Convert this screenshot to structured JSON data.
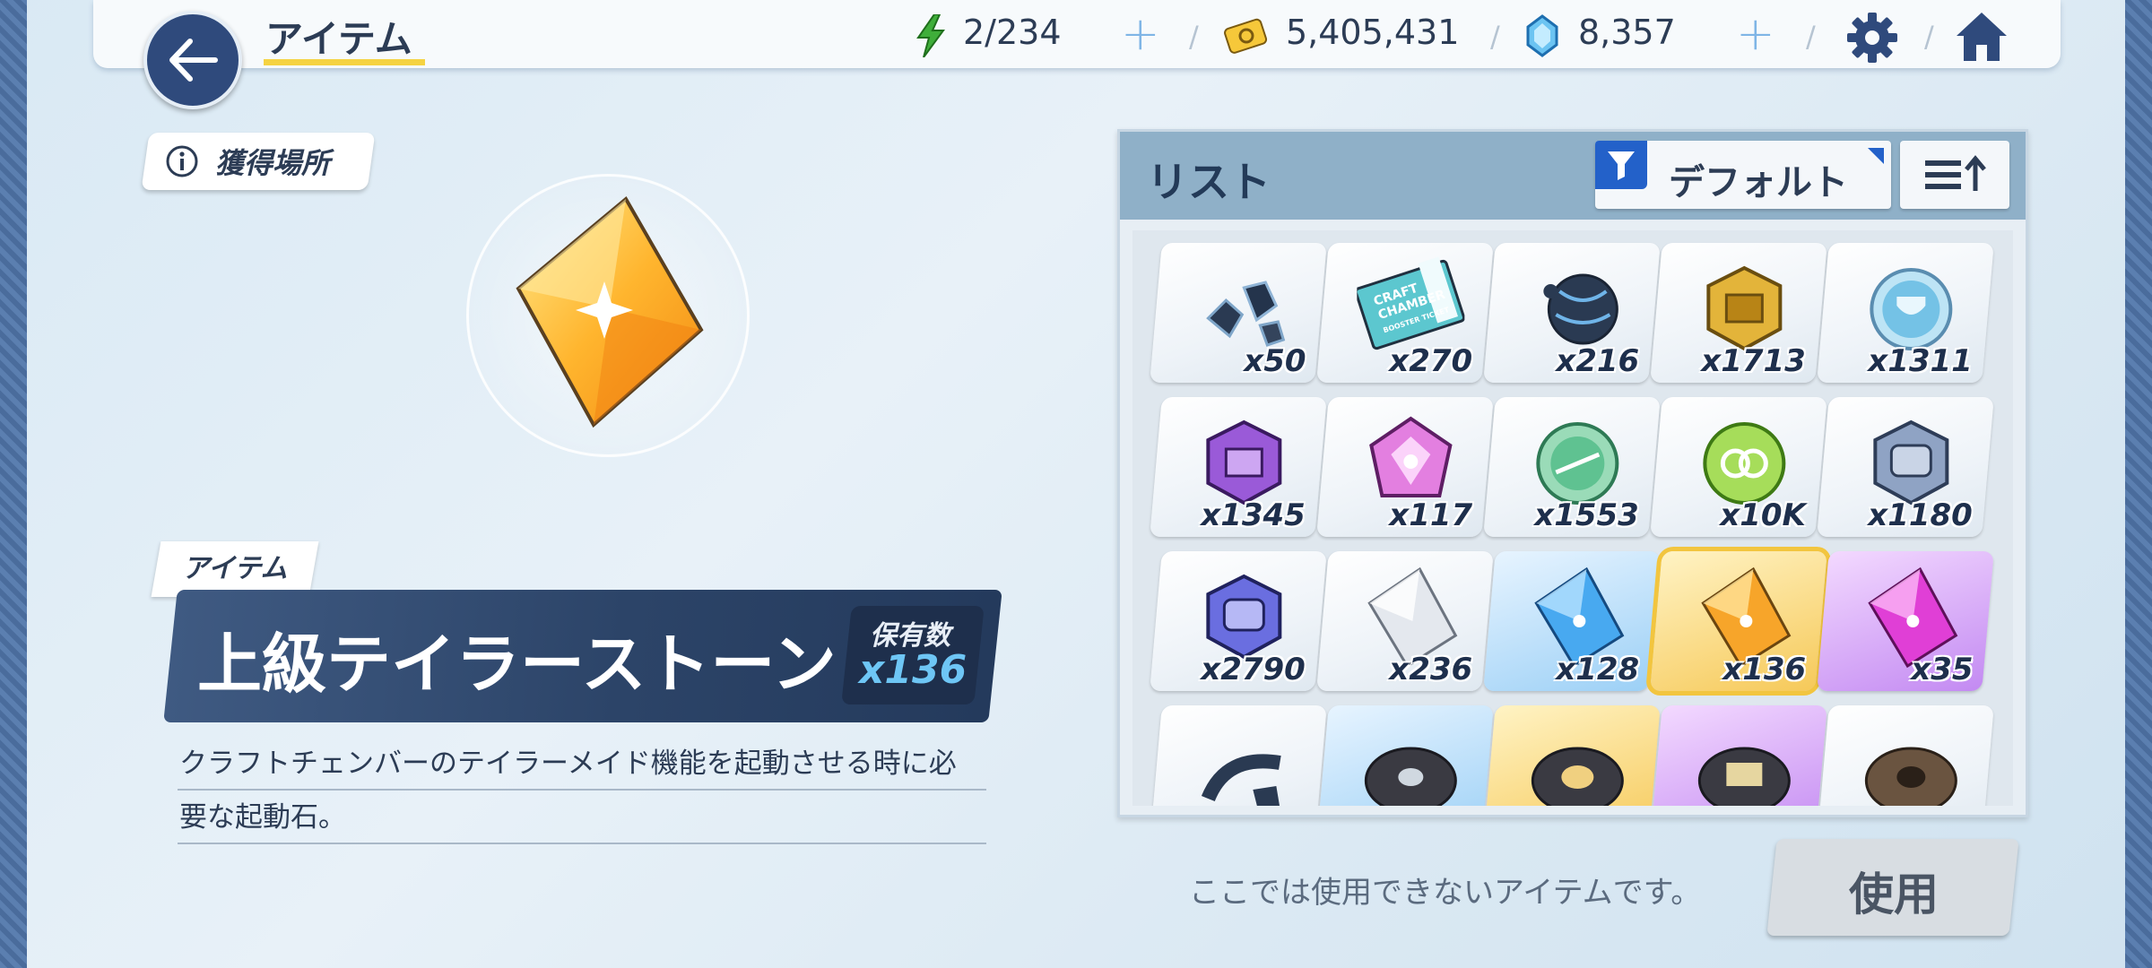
{
  "header": {
    "title": "アイテム",
    "stamina": "2/234",
    "credits": "5,405,431",
    "gems": "8,357"
  },
  "source_button": {
    "label": "獲得場所"
  },
  "detail": {
    "category": "アイテム",
    "name": "上級テイラーストーン",
    "owned_label": "保有数",
    "owned_count": "x136",
    "description_line1": "クラフトチェンバーのテイラーメイド機能を起動させる時に必",
    "description_line2": "要な起動石。"
  },
  "list": {
    "title": "リスト",
    "sort_label": "デフォルト",
    "items": [
      {
        "count": "x50",
        "icon": "scrap-chunks-icon",
        "bg": "white"
      },
      {
        "count": "x270",
        "icon": "booster-ticket-icon",
        "ticket_line1": "CRAFT",
        "ticket_line2": "CHAMBER",
        "ticket_line3": "BOOSTER TICKET",
        "bg": "white"
      },
      {
        "count": "x216",
        "icon": "dark-orb-icon",
        "bg": "white"
      },
      {
        "count": "x1713",
        "icon": "gold-chest-badge-icon",
        "bg": "white"
      },
      {
        "count": "x1311",
        "icon": "blue-trophy-coin-icon",
        "bg": "white"
      },
      {
        "count": "x1345",
        "icon": "purple-chest-badge-icon",
        "bg": "white"
      },
      {
        "count": "x117",
        "icon": "pink-gem-badge-icon",
        "bg": "white"
      },
      {
        "count": "x1553",
        "icon": "green-coin-icon",
        "bg": "white"
      },
      {
        "count": "x10K",
        "icon": "green-ring-coin-icon",
        "bg": "white"
      },
      {
        "count": "x1180",
        "icon": "steel-badge-icon",
        "bg": "white"
      },
      {
        "count": "x2790",
        "icon": "blue-badge-icon",
        "bg": "white"
      },
      {
        "count": "x236",
        "icon": "silver-stone-icon",
        "bg": "white"
      },
      {
        "count": "x128",
        "icon": "blue-stone-icon",
        "bg": "blue"
      },
      {
        "count": "x136",
        "icon": "gold-stone-icon",
        "bg": "gold",
        "selected": true
      },
      {
        "count": "x35",
        "icon": "pink-stone-icon",
        "bg": "purple"
      },
      {
        "count": "",
        "icon": "broken-part-icon",
        "bg": "white"
      },
      {
        "count": "",
        "icon": "gray-disc-icon",
        "bg": "blue"
      },
      {
        "count": "",
        "icon": "gold-disc-icon",
        "bg": "gold"
      },
      {
        "count": "",
        "icon": "purple-disc-icon",
        "bg": "purple"
      },
      {
        "count": "",
        "icon": "bronze-disc-icon",
        "bg": "white"
      }
    ]
  },
  "footer": {
    "note": "ここでは使用できないアイテムです。",
    "use_label": "使用"
  },
  "colors": {
    "accent_blue": "#2361c9",
    "underline_yellow": "#f5d342",
    "dark_navy": "#2c4468"
  }
}
